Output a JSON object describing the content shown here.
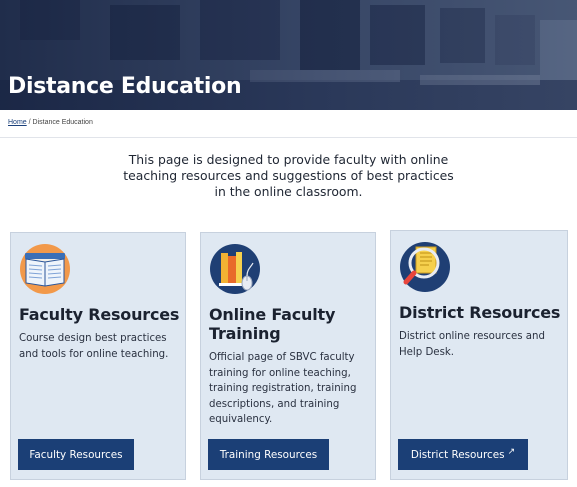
{
  "hero": {
    "title": "Distance Education"
  },
  "breadcrumb": {
    "home": "Home",
    "separator": " / ",
    "current": "Distance Education"
  },
  "intro": {
    "text": "This page is designed to provide faculty with online teaching resources and suggestions of best practices in the online classroom."
  },
  "cards": [
    {
      "icon": "open-book-icon",
      "title": "Faculty Resources",
      "description": "Course design best practices and tools for online teaching.",
      "button": "Faculty Resources"
    },
    {
      "icon": "books-mouse-icon",
      "title": "Online Faculty Training",
      "description": "Official page of SBVC faculty training for online teaching, training registration, training descriptions, and training equivalency.",
      "button": "Training Resources"
    },
    {
      "icon": "magnifier-document-icon",
      "title": "District Resources",
      "description": "District online resources and Help Desk.",
      "button": "District Resources",
      "button_icon": "external-link-icon"
    }
  ],
  "colors": {
    "button_bg": "#1b3f76",
    "card_bg": "#dfe8f2",
    "hero_text": "#ffffff"
  }
}
